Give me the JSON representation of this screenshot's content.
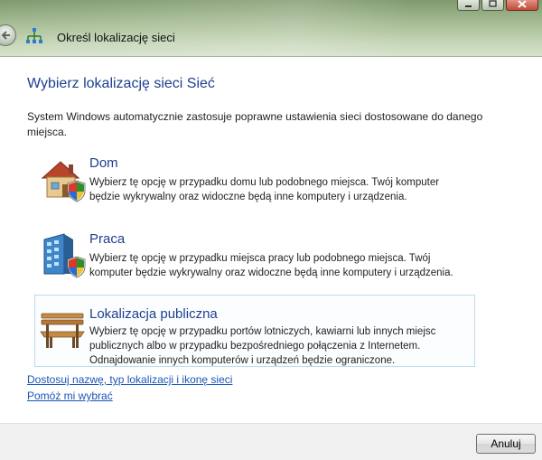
{
  "window": {
    "title": "Określ lokalizację sieci"
  },
  "main": {
    "heading": "Wybierz lokalizację sieci Sieć",
    "intro": "System Windows automatycznie zastosuje poprawne ustawienia sieci dostosowane do danego miejsca.",
    "options": [
      {
        "title": "Dom",
        "description": "Wybierz tę opcję w przypadku domu lub podobnego miejsca. Twój komputer będzie wykrywalny oraz widoczne będą inne komputery i urządzenia.",
        "icon": "house-shield-icon"
      },
      {
        "title": "Praca",
        "description": "Wybierz tę opcję w przypadku miejsca pracy lub podobnego miejsca. Twój komputer będzie wykrywalny oraz widoczne będą inne komputery i urządzenia.",
        "icon": "office-building-shield-icon"
      },
      {
        "title": "Lokalizacja publiczna",
        "description": "Wybierz tę opcję w przypadku portów lotniczych, kawiarni lub innych miejsc publicznych albo w przypadku bezpośredniego połączenia z Internetem. Odnajdowanie innych komputerów i urządzeń będzie ograniczone.",
        "icon": "park-bench-icon"
      }
    ],
    "links": {
      "customize": "Dostosuj nazwę, typ lokalizacji i ikonę sieci",
      "help": "Pomóż mi wybrać"
    }
  },
  "footer": {
    "cancel_label": "Anuluj"
  },
  "colors": {
    "heading": "#1e3f8f",
    "link": "#1a55b8",
    "selected_border": "#b9dced"
  }
}
